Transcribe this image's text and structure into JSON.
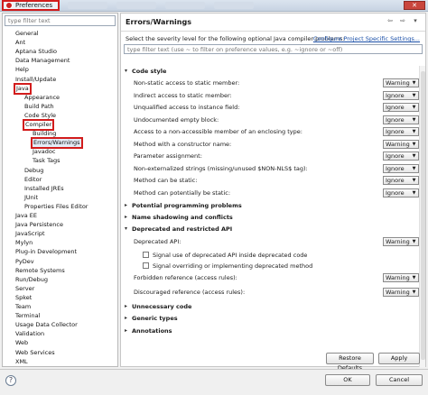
{
  "window": {
    "title": "Preferences",
    "close_label": "✕"
  },
  "left": {
    "filter_placeholder": "type filter text",
    "tree": [
      {
        "label": "General",
        "depth": 0
      },
      {
        "label": "Ant",
        "depth": 0
      },
      {
        "label": "Aptana Studio",
        "depth": 0
      },
      {
        "label": "Data Management",
        "depth": 0
      },
      {
        "label": "Help",
        "depth": 0
      },
      {
        "label": "Install/Update",
        "depth": 0
      },
      {
        "label": "Java",
        "depth": 0,
        "highlight": true
      },
      {
        "label": "Appearance",
        "depth": 1
      },
      {
        "label": "Build Path",
        "depth": 1
      },
      {
        "label": "Code Style",
        "depth": 1
      },
      {
        "label": "Compiler",
        "depth": 1,
        "highlight": true
      },
      {
        "label": "Building",
        "depth": 2
      },
      {
        "label": "Errors/Warnings",
        "depth": 2,
        "highlight": true,
        "selected": true
      },
      {
        "label": "Javadoc",
        "depth": 2
      },
      {
        "label": "Task Tags",
        "depth": 2
      },
      {
        "label": "Debug",
        "depth": 1
      },
      {
        "label": "Editor",
        "depth": 1
      },
      {
        "label": "Installed JREs",
        "depth": 1
      },
      {
        "label": "JUnit",
        "depth": 1
      },
      {
        "label": "Properties Files Editor",
        "depth": 1
      },
      {
        "label": "Java EE",
        "depth": 0
      },
      {
        "label": "Java Persistence",
        "depth": 0
      },
      {
        "label": "JavaScript",
        "depth": 0
      },
      {
        "label": "Mylyn",
        "depth": 0
      },
      {
        "label": "Plug-in Development",
        "depth": 0
      },
      {
        "label": "PyDev",
        "depth": 0
      },
      {
        "label": "Remote Systems",
        "depth": 0
      },
      {
        "label": "Run/Debug",
        "depth": 0
      },
      {
        "label": "Server",
        "depth": 0
      },
      {
        "label": "Spket",
        "depth": 0
      },
      {
        "label": "Team",
        "depth": 0
      },
      {
        "label": "Terminal",
        "depth": 0
      },
      {
        "label": "Usage Data Collector",
        "depth": 0
      },
      {
        "label": "Validation",
        "depth": 0
      },
      {
        "label": "Web",
        "depth": 0
      },
      {
        "label": "Web Services",
        "depth": 0
      },
      {
        "label": "XML",
        "depth": 0
      }
    ]
  },
  "right": {
    "title": "Errors/Warnings",
    "description": "Select the severity level for the following optional Java compiler problems:",
    "configure_link": "Configure Project Specific Settings...",
    "filter_placeholder": "type filter text (use ~ to filter on preference values, e.g. ~ignore or ~off)",
    "rows": [
      {
        "kind": "section",
        "label": "Code style",
        "expanded": true
      },
      {
        "kind": "option",
        "label": "Non-static access to static member:",
        "value": "Warning"
      },
      {
        "kind": "option",
        "label": "Indirect access to static member:",
        "value": "Ignore"
      },
      {
        "kind": "option",
        "label": "Unqualified access to instance field:",
        "value": "Ignore"
      },
      {
        "kind": "option",
        "label": "Undocumented empty block:",
        "value": "Ignore"
      },
      {
        "kind": "option",
        "label": "Access to a non-accessible member of an enclosing type:",
        "value": "Ignore"
      },
      {
        "kind": "option",
        "label": "Method with a constructor name:",
        "value": "Warning"
      },
      {
        "kind": "option",
        "label": "Parameter assignment:",
        "value": "Ignore"
      },
      {
        "kind": "option",
        "label": "Non-externalized strings (missing/unused $NON-NLS$ tag):",
        "value": "Ignore"
      },
      {
        "kind": "option",
        "label": "Method can be static:",
        "value": "Ignore"
      },
      {
        "kind": "option",
        "label": "Method can potentially be static:",
        "value": "Ignore"
      },
      {
        "kind": "section",
        "label": "Potential programming problems",
        "expanded": false
      },
      {
        "kind": "section",
        "label": "Name shadowing and conflicts",
        "expanded": false
      },
      {
        "kind": "section",
        "label": "Deprecated and restricted API",
        "expanded": true
      },
      {
        "kind": "option",
        "label": "Deprecated API:",
        "value": "Warning"
      },
      {
        "kind": "check",
        "label": "Signal use of deprecated API inside deprecated code"
      },
      {
        "kind": "check",
        "label": "Signal overriding or implementing deprecated method"
      },
      {
        "kind": "option",
        "label": "Forbidden reference (access rules):",
        "value": "Warning"
      },
      {
        "kind": "option",
        "label": "Discouraged reference (access rules):",
        "value": "Warning"
      },
      {
        "kind": "section",
        "label": "Unnecessary code",
        "expanded": false
      },
      {
        "kind": "section",
        "label": "Generic types",
        "expanded": false
      },
      {
        "kind": "section",
        "label": "Annotations",
        "expanded": false
      }
    ]
  },
  "buttons": {
    "restore_defaults": "Restore Defaults",
    "apply": "Apply",
    "ok": "OK",
    "cancel": "Cancel"
  },
  "icons": {
    "help": "?",
    "back": "⇦",
    "forward": "⇨",
    "menu": "▾"
  }
}
